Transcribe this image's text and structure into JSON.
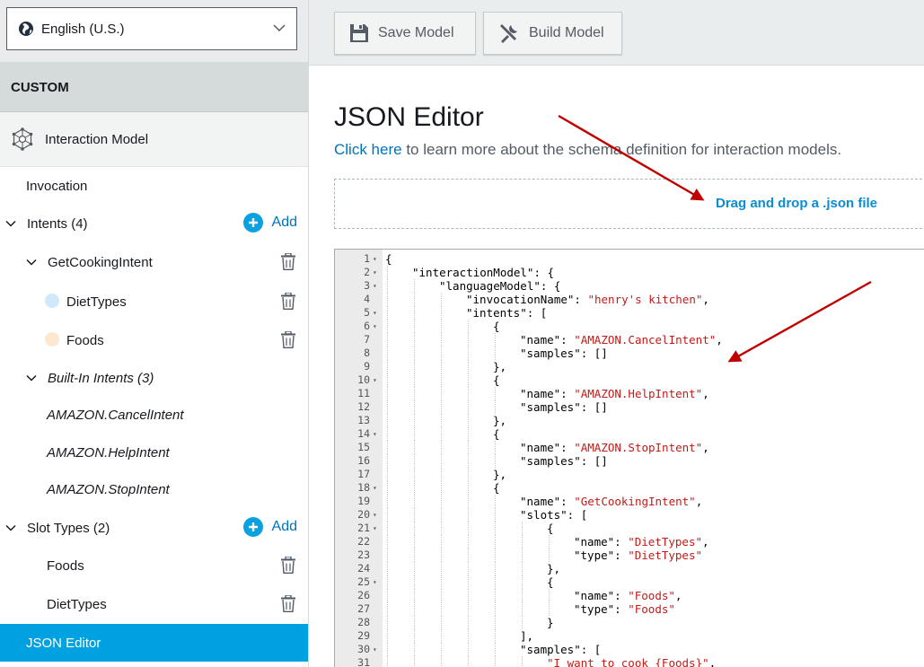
{
  "sidebar": {
    "language": "English (U.S.)",
    "section_header": "CUSTOM",
    "interaction_model": "Interaction Model",
    "invocation": "Invocation",
    "intents_label": "Intents (4)",
    "add_label": "Add",
    "get_cooking_intent": "GetCookingIntent",
    "slot_diet_types": "DietTypes",
    "slot_foods": "Foods",
    "builtin_label": "Built-In Intents (3)",
    "builtin_items": [
      "AMAZON.CancelIntent",
      "AMAZON.HelpIntent",
      "AMAZON.StopIntent"
    ],
    "slot_types_label": "Slot Types (2)",
    "slot_type_items": [
      "Foods",
      "DietTypes"
    ],
    "json_editor": "JSON Editor"
  },
  "toolbar": {
    "save_label": "Save Model",
    "build_label": "Build Model"
  },
  "main": {
    "title": "JSON Editor",
    "link_text": "Click here",
    "desc_rest": " to learn more about the schema definition for interaction models.",
    "dropzone_text": "Drag and drop a .json file"
  },
  "editor": {
    "lines": [
      {
        "n": "1",
        "fold": true,
        "indent": 0,
        "parts": [
          [
            "p",
            "{"
          ]
        ]
      },
      {
        "n": "2",
        "fold": true,
        "indent": 1,
        "parts": [
          [
            "p",
            "\"interactionModel\": {"
          ]
        ]
      },
      {
        "n": "3",
        "fold": true,
        "indent": 2,
        "parts": [
          [
            "p",
            "\"languageModel\": {"
          ]
        ]
      },
      {
        "n": "4",
        "fold": false,
        "indent": 3,
        "parts": [
          [
            "p",
            "\"invocationName\": "
          ],
          [
            "s",
            "\"henry's kitchen\""
          ],
          [
            "p",
            ","
          ]
        ]
      },
      {
        "n": "5",
        "fold": true,
        "indent": 3,
        "parts": [
          [
            "p",
            "\"intents\": ["
          ]
        ]
      },
      {
        "n": "6",
        "fold": true,
        "indent": 4,
        "parts": [
          [
            "p",
            "{"
          ]
        ]
      },
      {
        "n": "7",
        "fold": false,
        "indent": 5,
        "parts": [
          [
            "p",
            "\"name\": "
          ],
          [
            "s",
            "\"AMAZON.CancelIntent\""
          ],
          [
            "p",
            ","
          ]
        ]
      },
      {
        "n": "8",
        "fold": false,
        "indent": 5,
        "parts": [
          [
            "p",
            "\"samples\": []"
          ]
        ]
      },
      {
        "n": "9",
        "fold": false,
        "indent": 4,
        "parts": [
          [
            "p",
            "},"
          ]
        ]
      },
      {
        "n": "10",
        "fold": true,
        "indent": 4,
        "parts": [
          [
            "p",
            "{"
          ]
        ]
      },
      {
        "n": "11",
        "fold": false,
        "indent": 5,
        "parts": [
          [
            "p",
            "\"name\": "
          ],
          [
            "s",
            "\"AMAZON.HelpIntent\""
          ],
          [
            "p",
            ","
          ]
        ]
      },
      {
        "n": "12",
        "fold": false,
        "indent": 5,
        "parts": [
          [
            "p",
            "\"samples\": []"
          ]
        ]
      },
      {
        "n": "13",
        "fold": false,
        "indent": 4,
        "parts": [
          [
            "p",
            "},"
          ]
        ]
      },
      {
        "n": "14",
        "fold": true,
        "indent": 4,
        "parts": [
          [
            "p",
            "{"
          ]
        ]
      },
      {
        "n": "15",
        "fold": false,
        "indent": 5,
        "parts": [
          [
            "p",
            "\"name\": "
          ],
          [
            "s",
            "\"AMAZON.StopIntent\""
          ],
          [
            "p",
            ","
          ]
        ]
      },
      {
        "n": "16",
        "fold": false,
        "indent": 5,
        "parts": [
          [
            "p",
            "\"samples\": []"
          ]
        ]
      },
      {
        "n": "17",
        "fold": false,
        "indent": 4,
        "parts": [
          [
            "p",
            "},"
          ]
        ]
      },
      {
        "n": "18",
        "fold": true,
        "indent": 4,
        "parts": [
          [
            "p",
            "{"
          ]
        ]
      },
      {
        "n": "19",
        "fold": false,
        "indent": 5,
        "parts": [
          [
            "p",
            "\"name\": "
          ],
          [
            "s",
            "\"GetCookingIntent\""
          ],
          [
            "p",
            ","
          ]
        ]
      },
      {
        "n": "20",
        "fold": true,
        "indent": 5,
        "parts": [
          [
            "p",
            "\"slots\": ["
          ]
        ]
      },
      {
        "n": "21",
        "fold": true,
        "indent": 6,
        "parts": [
          [
            "p",
            "{"
          ]
        ]
      },
      {
        "n": "22",
        "fold": false,
        "indent": 7,
        "parts": [
          [
            "p",
            "\"name\": "
          ],
          [
            "s",
            "\"DietTypes\""
          ],
          [
            "p",
            ","
          ]
        ]
      },
      {
        "n": "23",
        "fold": false,
        "indent": 7,
        "parts": [
          [
            "p",
            "\"type\": "
          ],
          [
            "s",
            "\"DietTypes\""
          ]
        ]
      },
      {
        "n": "24",
        "fold": false,
        "indent": 6,
        "parts": [
          [
            "p",
            "},"
          ]
        ]
      },
      {
        "n": "25",
        "fold": true,
        "indent": 6,
        "parts": [
          [
            "p",
            "{"
          ]
        ]
      },
      {
        "n": "26",
        "fold": false,
        "indent": 7,
        "parts": [
          [
            "p",
            "\"name\": "
          ],
          [
            "s",
            "\"Foods\""
          ],
          [
            "p",
            ","
          ]
        ]
      },
      {
        "n": "27",
        "fold": false,
        "indent": 7,
        "parts": [
          [
            "p",
            "\"type\": "
          ],
          [
            "s",
            "\"Foods\""
          ]
        ]
      },
      {
        "n": "28",
        "fold": false,
        "indent": 6,
        "parts": [
          [
            "p",
            "}"
          ]
        ]
      },
      {
        "n": "29",
        "fold": false,
        "indent": 5,
        "parts": [
          [
            "p",
            "],"
          ]
        ]
      },
      {
        "n": "30",
        "fold": true,
        "indent": 5,
        "parts": [
          [
            "p",
            "\"samples\": ["
          ]
        ]
      },
      {
        "n": "31",
        "fold": false,
        "indent": 6,
        "parts": [
          [
            "s",
            "\"I want to cook {Foods}\""
          ],
          [
            "p",
            ","
          ]
        ]
      }
    ]
  },
  "colors": {
    "accent": "#00a1e0",
    "link": "#0073bb",
    "string": "#c41a16",
    "arrow": "#c00000"
  }
}
